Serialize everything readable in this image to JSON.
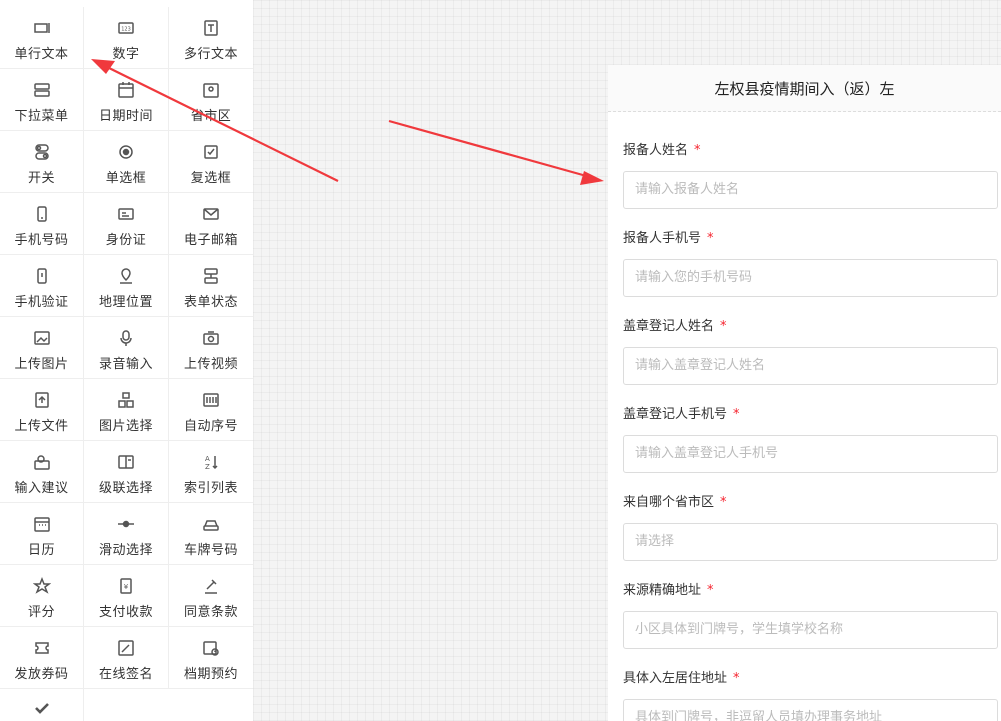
{
  "palette": {
    "items": [
      {
        "label": "单行文本",
        "icon": "text-input-icon"
      },
      {
        "label": "数字",
        "icon": "number-icon"
      },
      {
        "label": "多行文本",
        "icon": "multiline-text-icon"
      },
      {
        "label": "下拉菜单",
        "icon": "dropdown-icon"
      },
      {
        "label": "日期时间",
        "icon": "calendar-icon"
      },
      {
        "label": "省市区",
        "icon": "map-pin-icon"
      },
      {
        "label": "开关",
        "icon": "toggle-icon"
      },
      {
        "label": "单选框",
        "icon": "radio-icon"
      },
      {
        "label": "复选框",
        "icon": "checkbox-icon"
      },
      {
        "label": "手机号码",
        "icon": "phone-icon"
      },
      {
        "label": "身份证",
        "icon": "id-card-icon"
      },
      {
        "label": "电子邮箱",
        "icon": "mail-icon"
      },
      {
        "label": "手机验证",
        "icon": "phone-verify-icon"
      },
      {
        "label": "地理位置",
        "icon": "location-icon"
      },
      {
        "label": "表单状态",
        "icon": "form-status-icon"
      },
      {
        "label": "上传图片",
        "icon": "image-upload-icon"
      },
      {
        "label": "录音输入",
        "icon": "microphone-icon"
      },
      {
        "label": "上传视频",
        "icon": "camera-icon"
      },
      {
        "label": "上传文件",
        "icon": "file-upload-icon"
      },
      {
        "label": "图片选择",
        "icon": "image-choice-icon"
      },
      {
        "label": "自动序号",
        "icon": "barcode-icon"
      },
      {
        "label": "输入建议",
        "icon": "suggestion-icon"
      },
      {
        "label": "级联选择",
        "icon": "cascade-icon"
      },
      {
        "label": "索引列表",
        "icon": "sort-az-icon"
      },
      {
        "label": "日历",
        "icon": "calendar-grid-icon"
      },
      {
        "label": "滑动选择",
        "icon": "slider-icon"
      },
      {
        "label": "车牌号码",
        "icon": "car-icon"
      },
      {
        "label": "评分",
        "icon": "star-icon"
      },
      {
        "label": "支付收款",
        "icon": "payment-icon"
      },
      {
        "label": "同意条款",
        "icon": "gavel-icon"
      },
      {
        "label": "发放券码",
        "icon": "ticket-icon"
      },
      {
        "label": "在线签名",
        "icon": "signature-icon"
      },
      {
        "label": "档期预约",
        "icon": "schedule-icon"
      },
      {
        "label": "",
        "icon": "check-icon"
      }
    ]
  },
  "form": {
    "title": "左权县疫情期间入（返）左",
    "fields": [
      {
        "label": "报备人姓名",
        "placeholder": "请输入报备人姓名",
        "required": "*"
      },
      {
        "label": "报备人手机号",
        "placeholder": "请输入您的手机号码",
        "required": "*"
      },
      {
        "label": "盖章登记人姓名",
        "placeholder": "请输入盖章登记人姓名",
        "required": "*"
      },
      {
        "label": "盖章登记人手机号",
        "placeholder": "请输入盖章登记人手机号",
        "required": "*"
      },
      {
        "label": "来自哪个省市区",
        "placeholder": "请选择",
        "required": "*"
      },
      {
        "label": "来源精确地址",
        "placeholder": "小区具体到门牌号，学生填学校名称",
        "required": "*"
      },
      {
        "label": "具体入左居住地址",
        "placeholder": "具体到门牌号，非逗留人员填办理事务地址",
        "required": "*"
      }
    ]
  },
  "colors": {
    "arrow": "#f0393d",
    "required": "#f5222d"
  }
}
